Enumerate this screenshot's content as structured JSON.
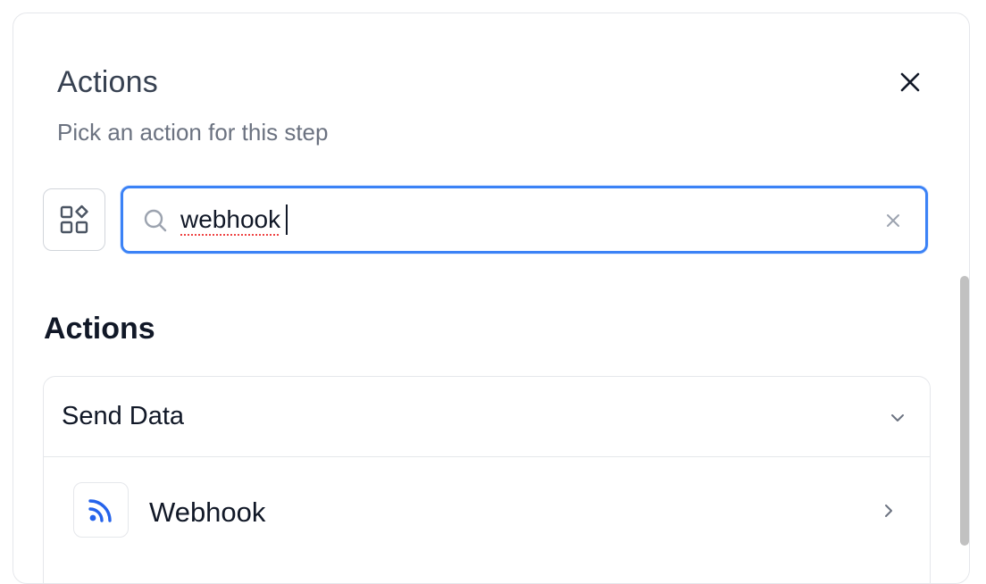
{
  "header": {
    "title": "Actions",
    "subtitle": "Pick an action for this step"
  },
  "search": {
    "value": "webhook",
    "accent_color": "#3b82f6"
  },
  "icons": {
    "close": "close-icon",
    "view_toggle": "apps-grid-icon",
    "search": "search-icon",
    "clear": "clear-icon",
    "group_chevron": "chevron-down-icon",
    "item_chevron": "chevron-right-icon",
    "webhook": "rss-feed-icon"
  },
  "section": {
    "heading": "Actions"
  },
  "group": {
    "title": "Send Data",
    "items": [
      {
        "label": "Webhook",
        "icon_color": "#2563eb"
      }
    ]
  }
}
